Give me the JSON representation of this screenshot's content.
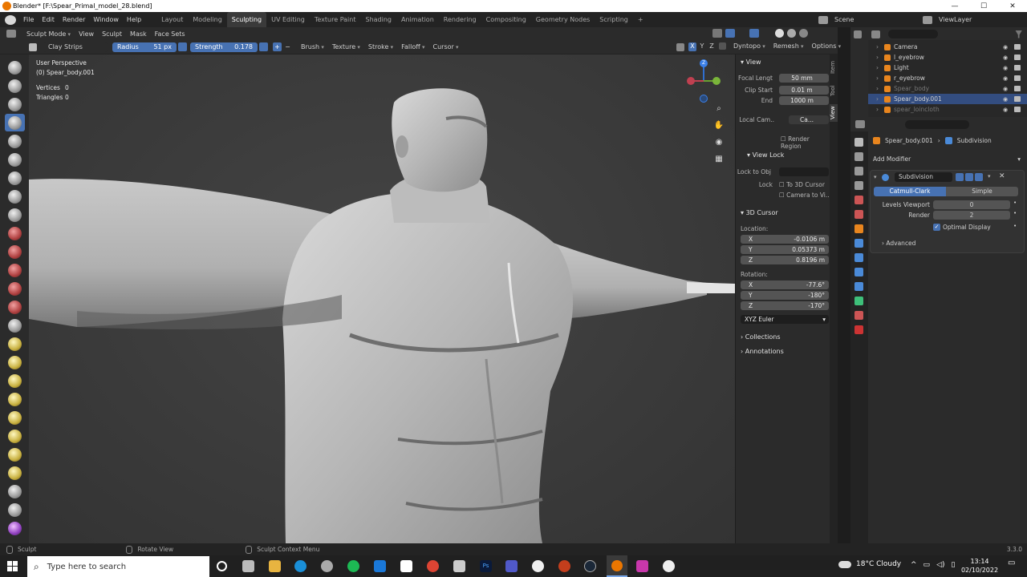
{
  "window": {
    "title": "Blender* [F:\\Spear_Primal_model_28.blend]",
    "minimize": "—",
    "maximize": "☐",
    "close": "✕"
  },
  "menubar": {
    "items": [
      "File",
      "Edit",
      "Render",
      "Window",
      "Help"
    ],
    "workspaces": [
      "Layout",
      "Modeling",
      "Sculpting",
      "UV Editing",
      "Texture Paint",
      "Shading",
      "Animation",
      "Rendering",
      "Compositing",
      "Geometry Nodes",
      "Scripting"
    ],
    "active_workspace": "Sculpting",
    "add_tab": "+",
    "scene": "Scene",
    "view_layer": "ViewLayer"
  },
  "header3d": {
    "mode": "Sculpt Mode",
    "items": [
      "View",
      "Sculpt",
      "Mask",
      "Face Sets"
    ]
  },
  "toolsettings": {
    "brush_name": "Clay Strips",
    "radius_label": "Radius",
    "radius_value": "51 px",
    "strength_label": "Strength",
    "strength_value": "0.178",
    "plus": "+",
    "minus": "−",
    "menus": [
      "Brush",
      "Texture",
      "Stroke",
      "Falloff",
      "Cursor"
    ],
    "axes": [
      "X",
      "Y",
      "Z"
    ],
    "right_menus": [
      "Dyntopo",
      "Remesh",
      "Options"
    ]
  },
  "viewport": {
    "perspective": "User Perspective",
    "object": "(0) Spear_body.001",
    "vertices_label": "Vertices",
    "vertices_value": "0",
    "triangles_label": "Triangles",
    "triangles_value": "0",
    "gizmo": {
      "z": "Z"
    }
  },
  "npanel": {
    "view_section": "View",
    "focal_label": "Focal Lengt",
    "focal_value": "50 mm",
    "clip_start_label": "Clip Start",
    "clip_start_value": "0.01 m",
    "end_label": "End",
    "end_value": "1000 m",
    "local_cam_label": "Local Cam..",
    "local_cam_value": "Ca...",
    "render_region": "Render Region",
    "view_lock_section": "View Lock",
    "lock_to_obj": "Lock to Obj",
    "lock_label": "Lock",
    "to_3d_cursor": "To 3D Cursor",
    "camera_to_view": "Camera to Vi...",
    "cursor_section": "3D Cursor",
    "location_label": "Location:",
    "loc": [
      {
        "axis": "X",
        "value": "-0.0106 m"
      },
      {
        "axis": "Y",
        "value": "0.05373 m"
      },
      {
        "axis": "Z",
        "value": "0.8196 m"
      }
    ],
    "rotation_label": "Rotation:",
    "rot": [
      {
        "axis": "X",
        "value": "-77.6°"
      },
      {
        "axis": "Y",
        "value": "-180°"
      },
      {
        "axis": "Z",
        "value": "-170°"
      }
    ],
    "rotation_mode": "XYZ Euler",
    "collections": "Collections",
    "annotations": "Annotations",
    "tabs": [
      "Item",
      "Tool",
      "View"
    ]
  },
  "outliner": {
    "rows": [
      {
        "name": "Camera",
        "muted": false,
        "selected": false
      },
      {
        "name": "l_eyebrow",
        "muted": false,
        "selected": false
      },
      {
        "name": "Light",
        "muted": false,
        "selected": false
      },
      {
        "name": "r_eyebrow",
        "muted": false,
        "selected": false
      },
      {
        "name": "Spear_body",
        "muted": true,
        "selected": false
      },
      {
        "name": "Spear_body.001",
        "muted": false,
        "selected": true
      },
      {
        "name": "spear_loincloth",
        "muted": true,
        "selected": false
      }
    ]
  },
  "properties": {
    "object": "Spear_body.001",
    "modifier_crumb": "Subdivision",
    "add_modifier": "Add Modifier",
    "modifier_name": "Subdivision",
    "catmull": "Catmull-Clark",
    "simple": "Simple",
    "levels_viewport_label": "Levels Viewport",
    "levels_viewport_value": "0",
    "render_label": "Render",
    "render_value": "2",
    "optimal_display": "Optimal Display",
    "advanced": "Advanced"
  },
  "statusbar": {
    "left": "Sculpt",
    "middle": "Rotate View",
    "context": "Sculpt Context Menu",
    "version": "3.3.0"
  },
  "taskbar": {
    "search_placeholder": "Type here to search",
    "weather": "18°C  Cloudy",
    "time": "13:14",
    "date": "02/10/2022"
  },
  "colors": {
    "accent": "#4772b3",
    "selected_row": "#334d80",
    "bg": "#2b2b2b",
    "viewport_bg": "#3d3d3d"
  }
}
